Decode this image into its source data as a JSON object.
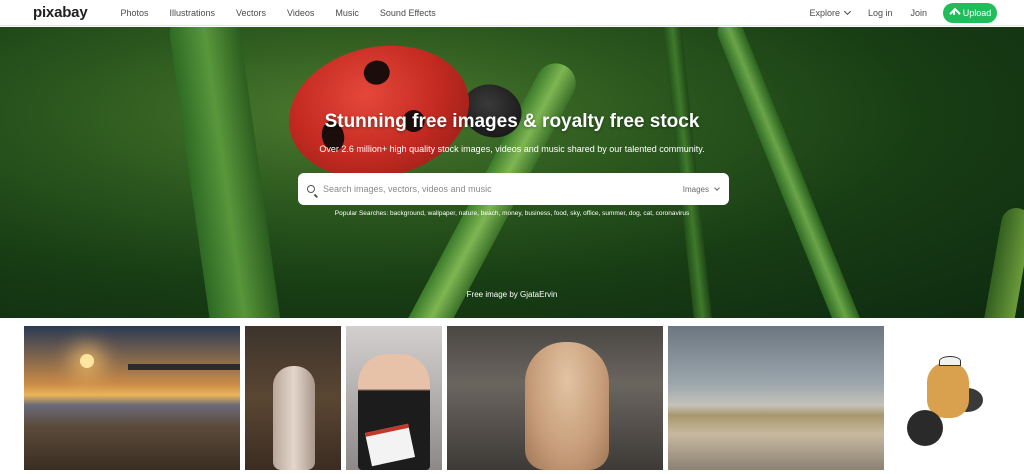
{
  "header": {
    "logo": "pixabay",
    "nav": [
      "Photos",
      "Illustrations",
      "Vectors",
      "Videos",
      "Music",
      "Sound Effects"
    ],
    "explore_label": "Explore",
    "login_label": "Log in",
    "join_label": "Join",
    "upload_label": "Upload"
  },
  "hero": {
    "title": "Stunning free images & royalty free stock",
    "subtitle": "Over 2.6 million+ high quality stock images, videos and music shared by our talented community.",
    "search_placeholder": "Search images, vectors, videos and music",
    "search_filter": "Images",
    "popular_searches": "Popular Searches: background, wallpaper, nature, beach, money, business, food, sky, office, summer, dog, cat, coronavirus",
    "credit": "Free image by GjataErvin"
  },
  "colors": {
    "accent": "#1fbe5a"
  }
}
